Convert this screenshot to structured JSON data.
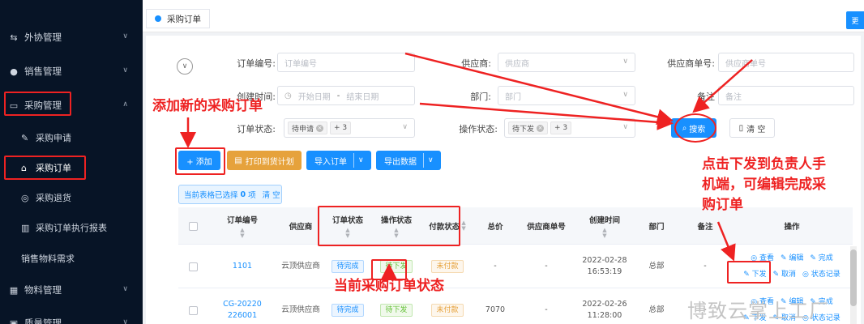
{
  "sidebar": {
    "items": [
      {
        "label": "外协管理",
        "icon": "transfer-icon"
      },
      {
        "label": "销售管理",
        "icon": "group-icon"
      },
      {
        "label": "采购管理",
        "icon": "cart-icon"
      },
      {
        "label": "物料管理",
        "icon": "box-icon"
      },
      {
        "label": "质量管理",
        "icon": "quality-icon"
      }
    ],
    "subitems": [
      {
        "label": "采购申请",
        "icon": "edit-icon"
      },
      {
        "label": "采购订单",
        "icon": "cart-icon"
      },
      {
        "label": "采购退货",
        "icon": "return-icon"
      },
      {
        "label": "采购订单执行报表",
        "icon": "report-icon"
      },
      {
        "label": "销售物料需求"
      }
    ]
  },
  "tabbar": {
    "tab_label": "采购订单",
    "right_button": "更"
  },
  "filters": {
    "order_no_label": "订单编号:",
    "order_no_placeholder": "订单编号",
    "supplier_label": "供应商:",
    "supplier_placeholder": "供应商",
    "supplier_order_label": "供应商单号:",
    "supplier_order_placeholder": "供应商单号",
    "created_label": "创建时间:",
    "start_placeholder": "开始日期",
    "date_sep": "-",
    "end_placeholder": "结束日期",
    "dept_label": "部门:",
    "dept_placeholder": "部门",
    "remark_label": "备注",
    "remark_placeholder": "备注",
    "order_status_label": "订单状态:",
    "order_status_tag": "待申请",
    "order_status_more": "+ 3",
    "op_status_label": "操作状态:",
    "op_status_tag": "待下发",
    "op_status_more": "+ 3",
    "search_label": "搜索",
    "clear_label": "清 空"
  },
  "toolbar": {
    "add_label": "+ 添加",
    "print_label": "打印到货计划",
    "import_label": "导入订单",
    "export_label": "导出数据"
  },
  "selection": {
    "prefix": "当前表格已选择",
    "count": "0",
    "suffix": "项",
    "clear": "清 空"
  },
  "table": {
    "headers": [
      "订单编号",
      "供应商",
      "订单状态",
      "操作状态",
      "付款状态",
      "总价",
      "供应商单号",
      "创建时间",
      "部门",
      "备注",
      "操作"
    ],
    "rows": [
      {
        "order_no": "1101",
        "supplier": "云顶供应商",
        "order_status": "待完成",
        "op_status": "待下发",
        "pay_status": "未付款",
        "total": "-",
        "supplier_no": "-",
        "created_date": "2022-02-28",
        "created_time": "16:53:19",
        "dept": "总部",
        "remark": "-",
        "ops1": [
          "◎ 查看",
          "✎ 编辑",
          "✎ 完成"
        ],
        "ops2": [
          "✎ 下发",
          "✎ 取消",
          "◎ 状态记录"
        ]
      },
      {
        "order_no_1": "CG-20220",
        "order_no_2": "226001",
        "supplier": "云顶供应商",
        "order_status": "待完成",
        "op_status": "待下发",
        "pay_status": "未付款",
        "total": "7070",
        "supplier_no": "-",
        "created_date": "2022-02-26",
        "created_time": "11:28:00",
        "dept": "总部",
        "remark": "-",
        "ops1": [
          "◎ 查看",
          "✎ 编辑",
          "✎ 完成"
        ],
        "ops2": [
          "✎ 下发",
          "✎ 取消",
          "◎ 状态记录"
        ]
      }
    ]
  },
  "annotations": {
    "add_new": "添加新的采购订单",
    "issue_line1": "点击下发到负责人手",
    "issue_line2": "机端，可编辑完成采",
    "issue_line3": "购订单",
    "status_note": "当前采购订单状态",
    "color": "#ee2222"
  },
  "watermark": "博致云掌上工厂"
}
